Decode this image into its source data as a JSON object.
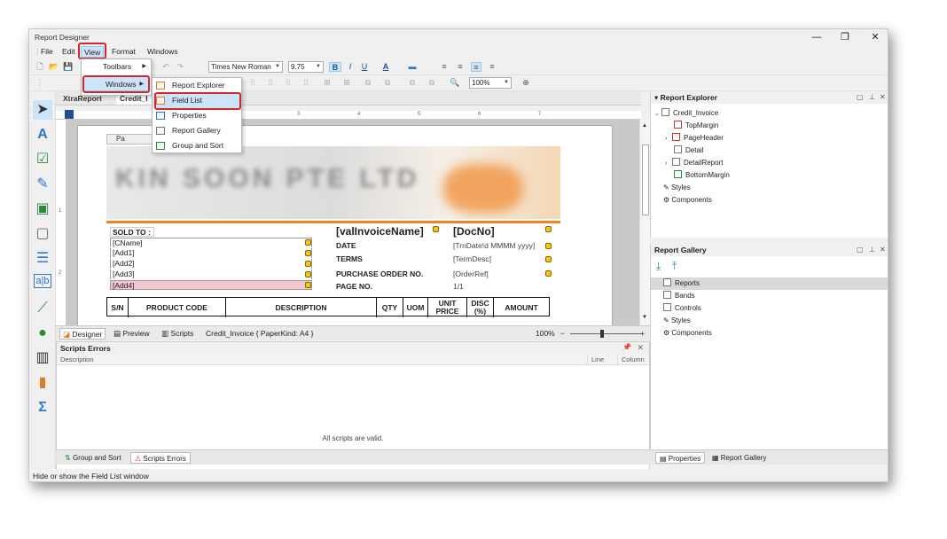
{
  "window": {
    "title": "Report Designer",
    "controls": [
      "—",
      "❐",
      "✕"
    ]
  },
  "menu": {
    "items": [
      "File",
      "Edit",
      "View",
      "Format",
      "Windows"
    ]
  },
  "toolbar": {
    "font_name": "Times New Roman",
    "font_size": "9.75",
    "zoom": "100%",
    "bold": "B",
    "italic": "I",
    "underline": "U",
    "font_color": "A"
  },
  "view_menu": {
    "items": [
      {
        "label": "Toolbars",
        "has_submenu": true
      },
      {
        "label": "Windows",
        "has_submenu": true
      }
    ]
  },
  "windows_submenu": {
    "items": [
      "Report Explorer",
      "Field List",
      "Properties",
      "Report Gallery",
      "Group and Sort"
    ]
  },
  "doc_tabs": [
    "XtraReport",
    "Credit_I"
  ],
  "ruler": {
    "marks": [
      "3",
      "4",
      "5",
      "6",
      "7"
    ],
    "left_marks": [
      "1",
      "2"
    ]
  },
  "report": {
    "band_label": "Pa",
    "sold_to": "SOLD TO :",
    "fields": [
      "[CName]",
      "[Add1]",
      "[Add2]",
      "[Add3]",
      "[Add4]"
    ],
    "title_field": "[valInvoiceName]",
    "doc_field": "[DocNo]",
    "labels": [
      "DATE",
      "TERMS",
      "PURCHASE ORDER NO.",
      "PAGE NO."
    ],
    "values": [
      "[TrnDate!d MMMM yyyy]",
      "[TermDesc]",
      "[OrderRef]",
      "1/1"
    ],
    "table_headers": [
      "S/N",
      "PRODUCT CODE",
      "DESCRIPTION",
      "QTY",
      "UOM",
      "UNIT PRICE",
      "DISC (%)",
      "AMOUNT"
    ],
    "blurred_company": "KIN SOON PTE LTD"
  },
  "designer_bar": {
    "tabs": [
      "Designer",
      "Preview",
      "Scripts"
    ],
    "info": "Credit_Invoice { PaperKind: A4 }",
    "zoom": "100%"
  },
  "scripts_errors": {
    "title": "Scripts Errors",
    "columns": [
      "Description",
      "Line",
      "Column"
    ],
    "message": "All scripts are valid."
  },
  "bottom_tabs": [
    "Group and Sort",
    "Scripts Errors"
  ],
  "status": "Hide or show the Field List window",
  "report_explorer": {
    "title": "Report Explorer",
    "root": "Credit_Invoice",
    "items": [
      "TopMargin",
      "PageHeader",
      "Detail",
      "DetailReport",
      "BottomMargin"
    ],
    "extras": [
      "Styles",
      "Components"
    ]
  },
  "report_gallery": {
    "title": "Report Gallery",
    "items": [
      "Reports",
      "Bands",
      "Controls",
      "Styles",
      "Components"
    ]
  },
  "right_bottom_tabs": [
    "Properties",
    "Report Gallery"
  ],
  "colors": {
    "accent": "#f58220",
    "highlight": "#d6262d",
    "selection": "#cce4f7"
  }
}
